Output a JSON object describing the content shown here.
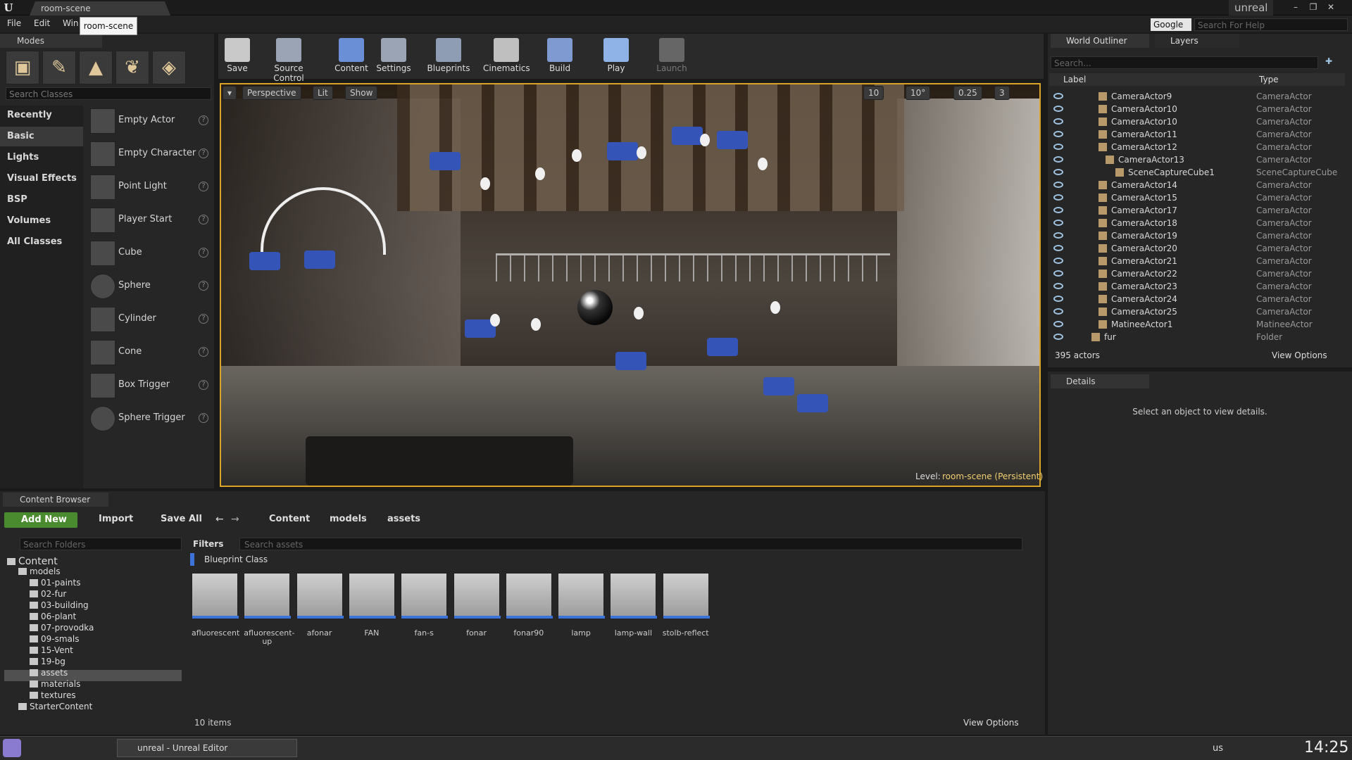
{
  "title_bar": {
    "logo": "U",
    "document_tab": "room-scene",
    "project": "unreal"
  },
  "menu": {
    "items": [
      "File",
      "Edit",
      "Win"
    ],
    "tooltip": "room-scene",
    "help_provider": "Google",
    "help_search_placeholder": "Search For Help"
  },
  "modes": {
    "tab": "Modes",
    "search_placeholder": "Search Classes",
    "categories": [
      "Recently Placed",
      "Basic",
      "Lights",
      "Visual Effects",
      "BSP",
      "Volumes",
      "All Classes"
    ],
    "items": [
      "Empty Actor",
      "Empty Character",
      "Point Light",
      "Player Start",
      "Cube",
      "Sphere",
      "Cylinder",
      "Cone",
      "Box Trigger",
      "Sphere Trigger"
    ]
  },
  "toolbar": {
    "buttons": [
      {
        "label": "Save",
        "color": "#c9c9c9"
      },
      {
        "label": "Source Control",
        "color": "#9aa4b4"
      },
      {
        "label": "Content",
        "color": "#6b8fd6"
      },
      {
        "label": "Settings",
        "color": "#9aa4b4"
      },
      {
        "label": "Blueprints",
        "color": "#8f9db4"
      },
      {
        "label": "Cinematics",
        "color": "#bfbfbf"
      },
      {
        "label": "Build",
        "color": "#7e9ad0"
      },
      {
        "label": "Play",
        "color": "#8fb3e6"
      },
      {
        "label": "Launch",
        "color": "#666666"
      }
    ]
  },
  "viewport": {
    "perspective": "Perspective",
    "lit": "Lit",
    "show": "Show",
    "snap_values": [
      "10",
      "10°",
      "0.25",
      "3"
    ],
    "level_label": "Level:",
    "level_name": "room-scene (Persistent)"
  },
  "outliner": {
    "tabs": [
      "World Outliner",
      "Layers"
    ],
    "search_placeholder": "Search...",
    "col_label": "Label",
    "col_type": "Type",
    "rows": [
      {
        "label": "CameraActor9",
        "type": "CameraActor"
      },
      {
        "label": "CameraActor10",
        "type": "CameraActor"
      },
      {
        "label": "CameraActor10",
        "type": "CameraActor"
      },
      {
        "label": "CameraActor11",
        "type": "CameraActor"
      },
      {
        "label": "CameraActor12",
        "type": "CameraActor"
      },
      {
        "label": "CameraActor13",
        "type": "CameraActor"
      },
      {
        "label": "SceneCaptureCube1",
        "type": "SceneCaptureCube"
      },
      {
        "label": "CameraActor14",
        "type": "CameraActor"
      },
      {
        "label": "CameraActor15",
        "type": "CameraActor"
      },
      {
        "label": "CameraActor17",
        "type": "CameraActor"
      },
      {
        "label": "CameraActor18",
        "type": "CameraActor"
      },
      {
        "label": "CameraActor19",
        "type": "CameraActor"
      },
      {
        "label": "CameraActor20",
        "type": "CameraActor"
      },
      {
        "label": "CameraActor21",
        "type": "CameraActor"
      },
      {
        "label": "CameraActor22",
        "type": "CameraActor"
      },
      {
        "label": "CameraActor23",
        "type": "CameraActor"
      },
      {
        "label": "CameraActor24",
        "type": "CameraActor"
      },
      {
        "label": "CameraActor25",
        "type": "CameraActor"
      },
      {
        "label": "MatineeActor1",
        "type": "MatineeActor"
      },
      {
        "label": "fur",
        "type": "Folder"
      }
    ],
    "count": "395 actors",
    "view_options": "View Options"
  },
  "details": {
    "tab": "Details",
    "empty_text": "Select an object to view details."
  },
  "content_browser": {
    "tab": "Content Browser",
    "add_new": "Add New",
    "import": "Import",
    "save_all": "Save All",
    "breadcrumb": [
      "Content",
      "models",
      "assets"
    ],
    "folder_search_placeholder": "Search Folders",
    "filters": "Filters",
    "asset_search_placeholder": "Search assets",
    "tree": [
      "Content",
      "models",
      "01-paints",
      "02-fur",
      "03-building",
      "06-plant",
      "07-provodka",
      "09-smals",
      "15-Vent",
      "19-bg",
      "assets",
      "materials",
      "textures",
      "StarterContent"
    ],
    "selected_folder": "assets",
    "group_label": "Blueprint Class",
    "assets": [
      "afluorescent",
      "afluorescent-up",
      "afonar",
      "FAN",
      "fan-s",
      "fonar",
      "fonar90",
      "lamp",
      "lamp-wall",
      "stolb-reflect"
    ],
    "count": "10 items",
    "view_options": "View Options"
  },
  "taskbar": {
    "window_title": "unreal - Unreal Editor",
    "keyboard": "us",
    "clock": "14:25"
  }
}
